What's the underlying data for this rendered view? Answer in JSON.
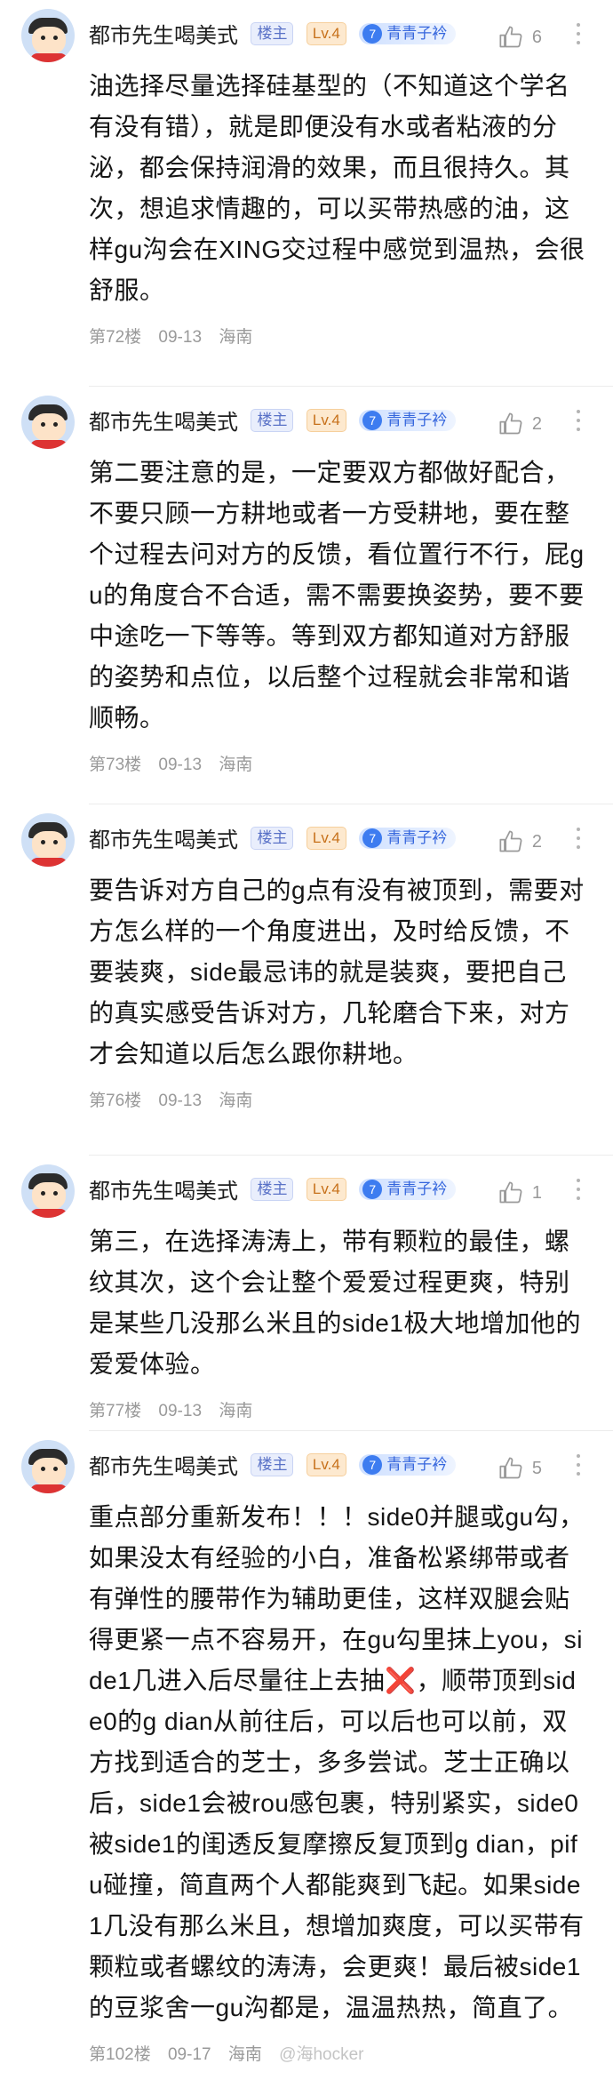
{
  "posts": [
    {
      "username": "都市先生喝美式",
      "owner_badge": "楼主",
      "level": "Lv.4",
      "fan_level": "7",
      "fan_name": "青青子衿",
      "likes": "6",
      "text": "油选择尽量选择硅基型的（不知道这个学名有没有错），就是即便没有水或者粘液的分泌，都会保持润滑的效果，而且很持久。其次，想追求情趣的，可以买带热感的油，这样gu沟会在XING交过程中感觉到温热，会很舒服。",
      "floor": "第72楼",
      "date": "09-13",
      "location": "海南"
    },
    {
      "username": "都市先生喝美式",
      "owner_badge": "楼主",
      "level": "Lv.4",
      "fan_level": "7",
      "fan_name": "青青子衿",
      "likes": "2",
      "text": "第二要注意的是，一定要双方都做好配合，不要只顾一方耕地或者一方受耕地，要在整个过程去问对方的反馈，看位置行不行，屁gu的角度合不合适，需不需要换姿势，要不要中途吃一下等等。等到双方都知道对方舒服的姿势和点位，以后整个过程就会非常和谐顺畅。",
      "floor": "第73楼",
      "date": "09-13",
      "location": "海南"
    },
    {
      "username": "都市先生喝美式",
      "owner_badge": "楼主",
      "level": "Lv.4",
      "fan_level": "7",
      "fan_name": "青青子衿",
      "likes": "2",
      "text": "要告诉对方自己的g点有没有被顶到，需要对方怎么样的一个角度进出，及时给反馈，不要装爽，side最忌讳的就是装爽，要把自己的真实感受告诉对方，几轮磨合下来，对方才会知道以后怎么跟你耕地。",
      "floor": "第76楼",
      "date": "09-13",
      "location": "海南"
    },
    {
      "username": "都市先生喝美式",
      "owner_badge": "楼主",
      "level": "Lv.4",
      "fan_level": "7",
      "fan_name": "青青子衿",
      "likes": "1",
      "text": "第三，在选择涛涛上，带有颗粒的最佳，螺纹其次，这个会让整个爱爱过程更爽，特别是某些几没那么米且的side1极大地增加他的爱爱体验。",
      "floor": "第77楼",
      "date": "09-13",
      "location": "海南"
    },
    {
      "username": "都市先生喝美式",
      "owner_badge": "楼主",
      "level": "Lv.4",
      "fan_level": "7",
      "fan_name": "青青子衿",
      "likes": "5",
      "text_a": "重点部分重新发布！！！side0并腿或gu勾，如果没太有经验的小白，准备松紧绑带或者有弹性的腰带作为辅助更佳，这样双腿会贴得更紧一点不容易开，在gu勾里抹上you，side1几进入后尽量往上去抽",
      "cross_mark": "❌",
      "text_b": "，顺带顶到side0的g dian从前往后，可以后也可以前，双方找到适合的芝士，多多尝试。芝士正确以后，side1会被rou感包裹，特别紧实，side0被side1的闺透反复摩擦反复顶到g dian，pifu碰撞，简直两个人都能爽到飞起。如果side1几没有那么米且，想增加爽度，可以买带有颗粒或者螺纹的涛涛，会更爽！最后被side1的豆浆舍一gu沟都是，温温热热，简直了。",
      "floor": "第102楼",
      "date": "09-17",
      "location": "海南",
      "watermark": "@海hocker"
    }
  ],
  "colors": {
    "accent": "#3d7cf0",
    "owner_badge_bg": "#e9eefc",
    "level_badge_bg": "#fde9cf",
    "cross": "#e5322d"
  },
  "icons": {
    "like": "thumbs-up-icon",
    "more": "more-vertical-icon"
  }
}
